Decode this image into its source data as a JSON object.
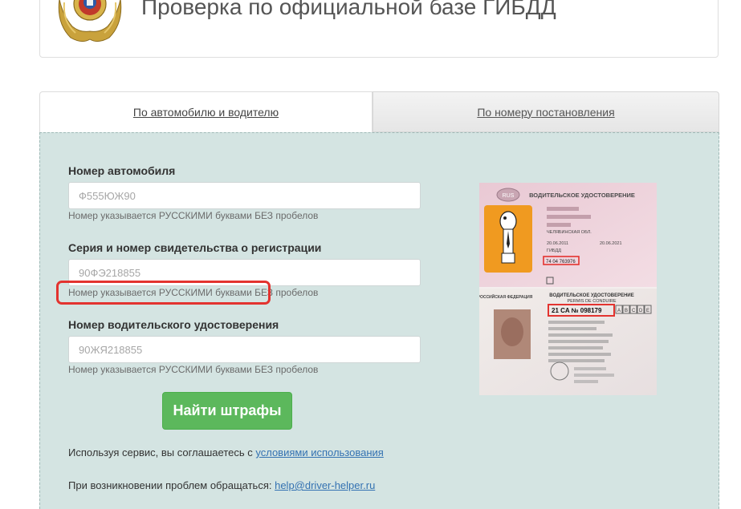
{
  "header": {
    "title": "Проверка по официальной базе ГИБДД"
  },
  "tabs": [
    {
      "label": "По автомобилю и водителю",
      "active": true
    },
    {
      "label": "По номеру постановления",
      "active": false
    }
  ],
  "form": {
    "car_number": {
      "label": "Номер автомобиля",
      "placeholder": "Ф555ЮЖ90",
      "hint": "Номер указывается РУССКИМИ буквами БЕЗ пробелов"
    },
    "registration": {
      "label": "Серия и номер свидетельства о регистрации",
      "placeholder": "90ФЭ218855",
      "hint": "Номер указывается РУССКИМИ буквами БЕЗ пробелов"
    },
    "license": {
      "label": "Номер водительского удостоверения",
      "placeholder": "90ЖЯ218855",
      "hint": "Номер указывается РУССКИМИ буквами БЕЗ пробелов"
    },
    "submit_label": "Найти штрафы"
  },
  "footer": {
    "terms_prefix": "Используя сервис, вы соглашаетесь с ",
    "terms_link": "условиями использования",
    "contact_prefix": "При возникновении проблем обращаться: ",
    "contact_email": "help@driver-helper.ru"
  },
  "licence_image": {
    "front_title": "ВОДИТЕЛЬСКОЕ УДОСТОВЕРЕНИЕ",
    "back_title": "ВОДИТЕЛЬСКОЕ УДОСТОВЕРЕНИЕ",
    "back_subtitle": "PERMIS DE CONDUIRE",
    "country_label": "RUS",
    "country_name": "РОССИЙСКАЯ ФЕДЕРАЦИЯ",
    "front_highlight": "74 04 763976",
    "back_highlight": "21 CA № 098179",
    "region": "ЧЕЛЯБИНСКАЯ ОБЛ.",
    "issued": "20.06.2011",
    "expires": "20.06.2021",
    "categories": [
      "A",
      "B",
      "C",
      "D",
      "E"
    ],
    "stamp": "ГИБДД"
  },
  "colors": {
    "panel_bg": "#d4e4e2",
    "button_green": "#5cb85c",
    "highlight_red": "#e3332f",
    "link_blue": "#3472b2"
  }
}
